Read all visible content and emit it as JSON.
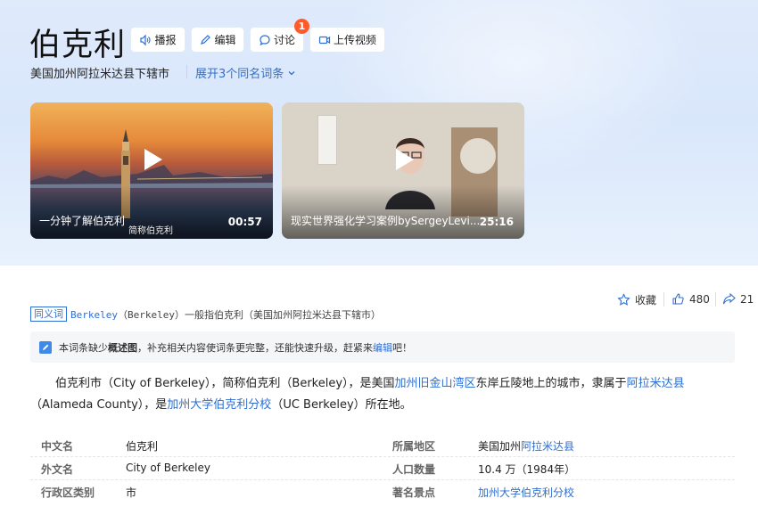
{
  "header": {
    "title": "伯克利",
    "buttons": {
      "broadcast": "播报",
      "edit": "编辑",
      "discuss": "讨论",
      "upload": "上传视频"
    },
    "discuss_badge": "1",
    "subtitle": "美国加州阿拉米达县下辖市",
    "expand": "展开3个同名词条"
  },
  "videos": [
    {
      "title": "一分钟了解伯克利",
      "sub": "简称伯克利",
      "duration": "00:57"
    },
    {
      "title": "现实世界强化学习案例bySergeyLevi...",
      "duration": "25:16"
    }
  ],
  "actions": {
    "favorite": "收藏",
    "likes": "480",
    "shares": "21"
  },
  "synonym": {
    "tag": "同义词",
    "term": "Berkeley",
    "rest": "（Berkeley）一般指伯克利（美国加州阿拉米达县下辖市）"
  },
  "notice": {
    "pre": "本词条缺少",
    "bold": "概述图",
    "mid": "，补充相关内容使词条更完整，还能快速升级，赶紧来",
    "link": "编辑",
    "post": "吧！"
  },
  "summary": {
    "p1": "伯克利市（City of Berkeley），简称伯克利（Berkeley），是美国",
    "l1": "加州旧金山湾区",
    "p2": "东岸丘陵地上的城市，隶属于",
    "l2": "阿拉米达县",
    "p3": "（Alameda County），是",
    "l3": "加州大学伯克利分校",
    "p4": "（UC Berkeley）所在地。"
  },
  "basic_info": {
    "k1": "中文名",
    "v1": "伯克利",
    "k2": "外文名",
    "v2": "City of Berkeley",
    "k3": "行政区类别",
    "v3": "市",
    "k4": "所属地区",
    "v4a": "美国加州",
    "v4b": "阿拉米达县",
    "k5": "人口数量",
    "v5": "10.4 万（1984年）",
    "k6": "著名景点",
    "v6": "加州大学伯克利分校"
  },
  "colors": {
    "accent": "#2e6fd1",
    "badge": "#ff5a29",
    "hero": "#dfeafb"
  },
  "icons": [
    "speaker-icon",
    "pencil-icon",
    "chat-icon",
    "video-camera-icon",
    "chevron-down-icon",
    "play-icon",
    "star-icon",
    "thumbs-up-icon",
    "share-icon",
    "edit-notice-icon"
  ]
}
